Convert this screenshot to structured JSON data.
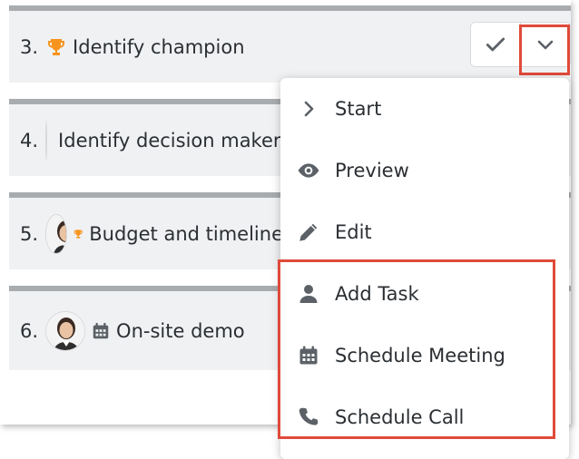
{
  "tasks": [
    {
      "number": "3.",
      "title": "Identify champion",
      "type_icon": "trophy-icon",
      "has_avatar": false
    },
    {
      "number": "4.",
      "title": "Identify decision makers",
      "type_icon": "trophy-icon",
      "has_avatar": true
    },
    {
      "number": "5.",
      "title": "Budget and timeline",
      "type_icon": "trophy-icon",
      "has_avatar": true
    },
    {
      "number": "6.",
      "title": "On-site demo",
      "type_icon": "calendar-icon",
      "has_avatar": true
    }
  ],
  "row_actions": {
    "complete_icon": "check-icon",
    "dropdown_icon": "chevron-down-icon"
  },
  "menu": {
    "items": [
      {
        "label": "Start",
        "icon": "chevron-right-icon"
      },
      {
        "label": "Preview",
        "icon": "eye-icon"
      },
      {
        "label": "Edit",
        "icon": "pencil-icon"
      },
      {
        "label": "Add Task",
        "icon": "person-icon"
      },
      {
        "label": "Schedule Meeting",
        "icon": "calendar-icon"
      },
      {
        "label": "Schedule Call",
        "icon": "phone-icon"
      }
    ]
  },
  "colors": {
    "trophy": "#f7941d",
    "highlight": "#e04a3a",
    "icon_gray": "#5b6167",
    "row_bg": "#f0f1f3",
    "row_border": "#a9acaf"
  }
}
